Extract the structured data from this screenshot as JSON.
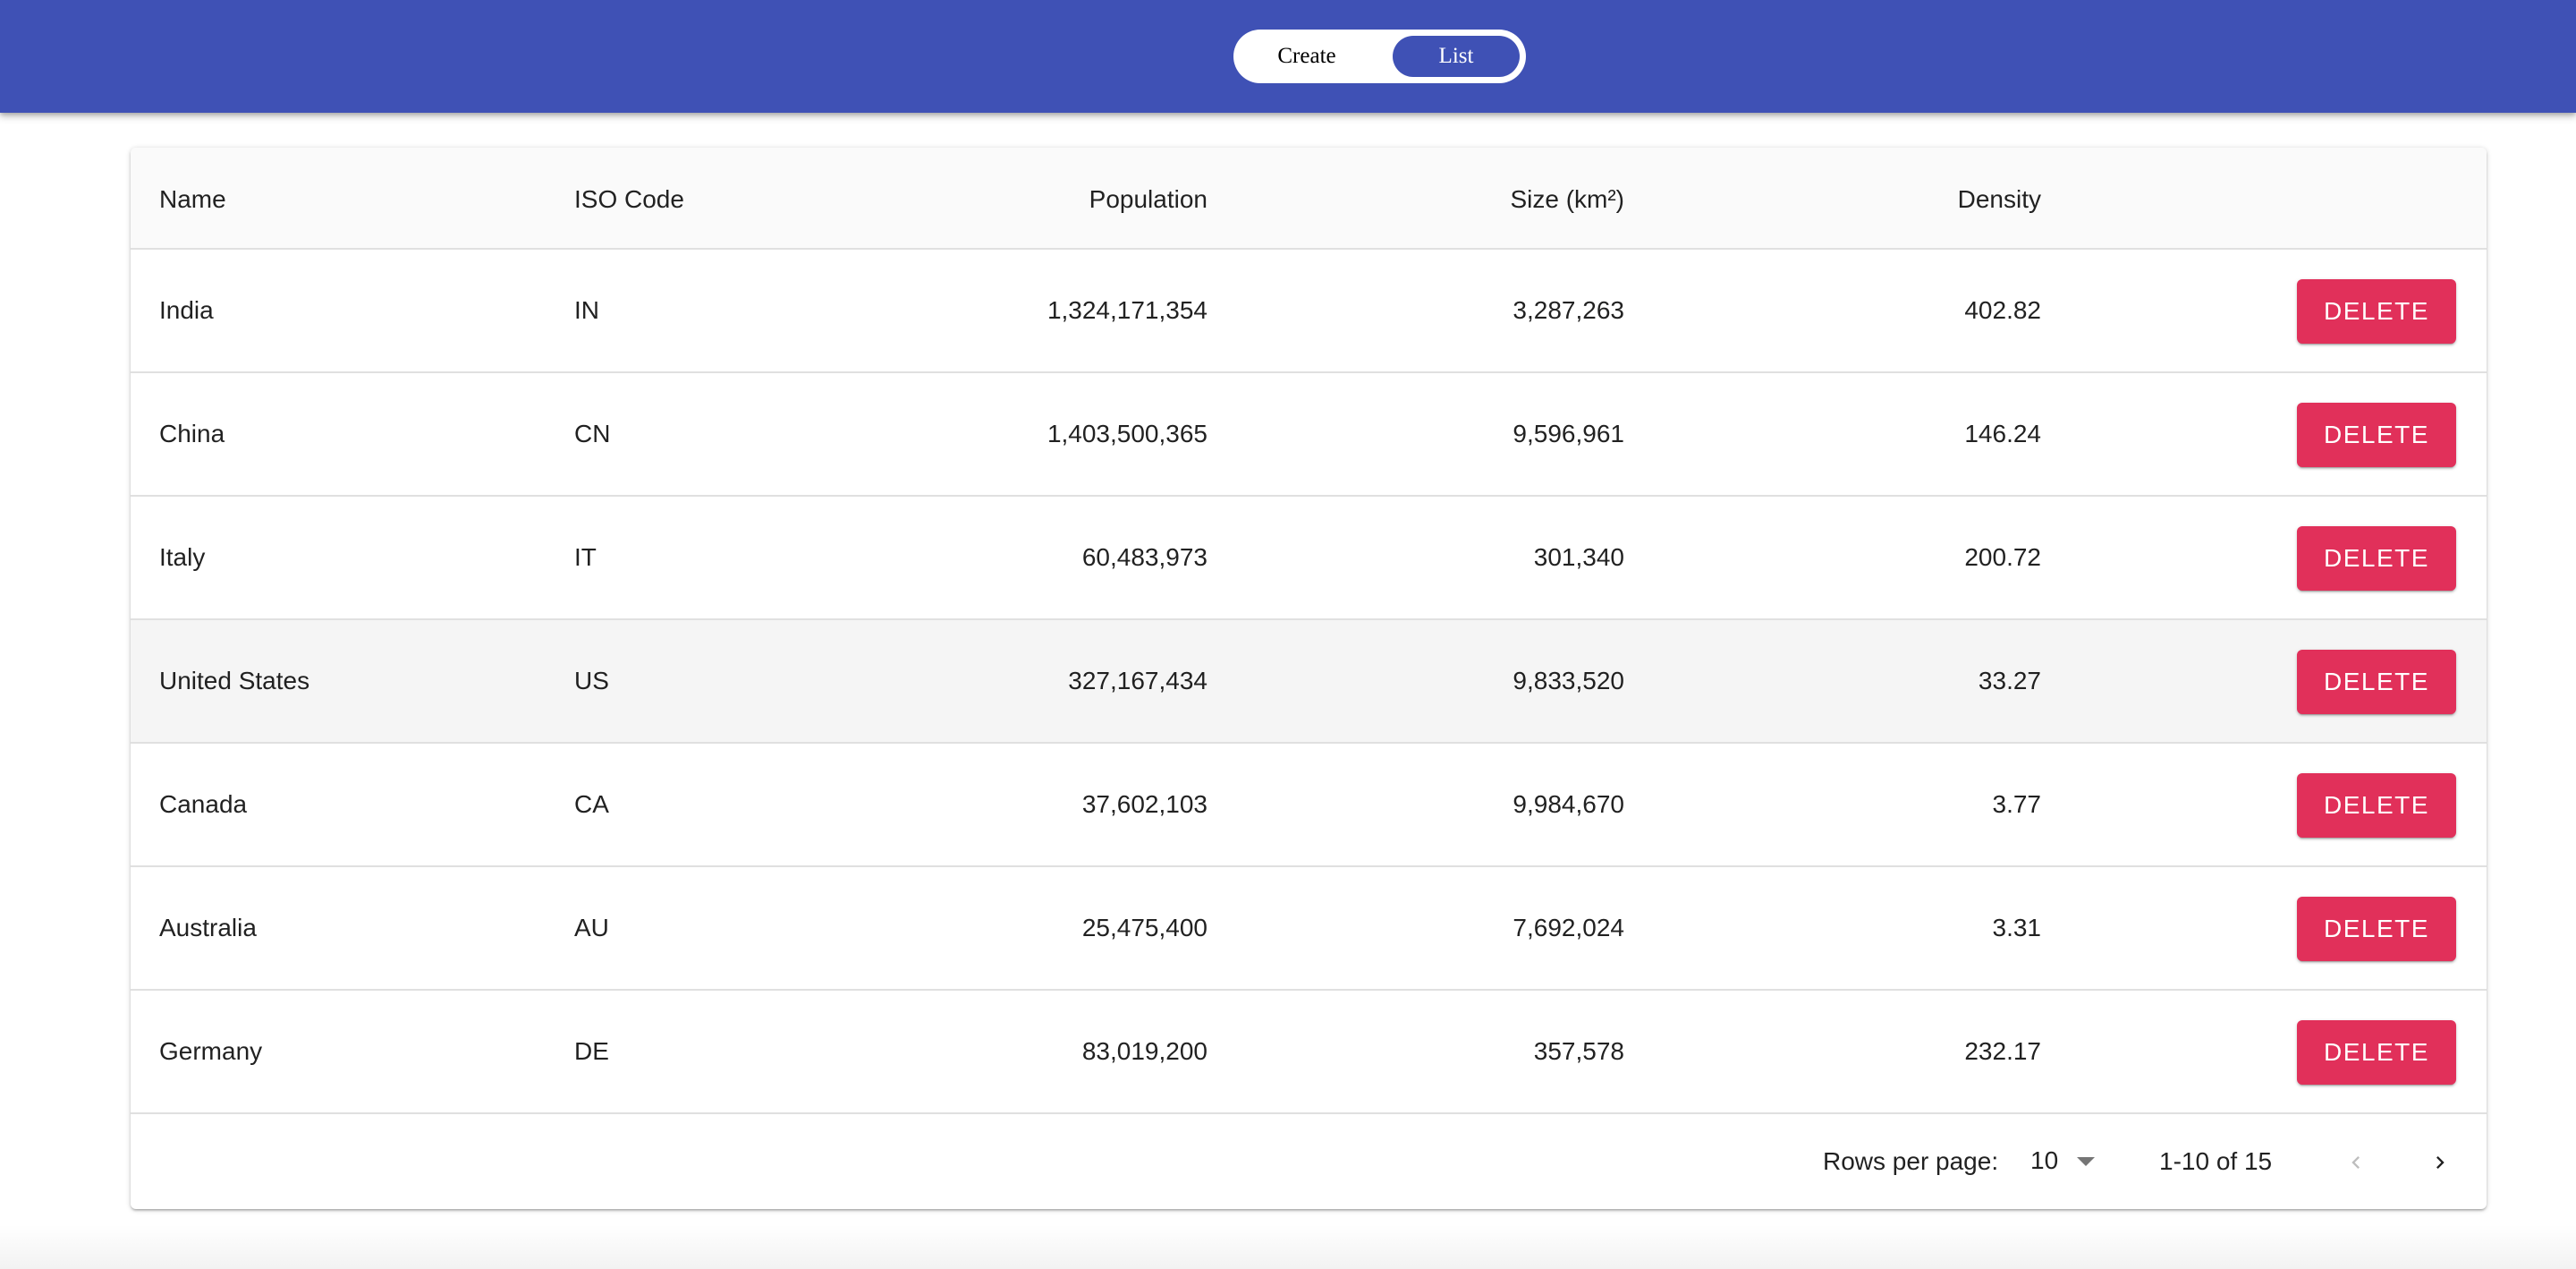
{
  "nav": {
    "create_label": "Create",
    "list_label": "List",
    "active": "List"
  },
  "table": {
    "headers": {
      "name": "Name",
      "iso": "ISO Code",
      "population": "Population",
      "size": "Size (km²)",
      "density": "Density"
    },
    "rows": [
      {
        "name": "India",
        "iso": "IN",
        "population": "1,324,171,354",
        "size": "3,287,263",
        "density": "402.82",
        "action": "DELETE"
      },
      {
        "name": "China",
        "iso": "CN",
        "population": "1,403,500,365",
        "size": "9,596,961",
        "density": "146.24",
        "action": "DELETE"
      },
      {
        "name": "Italy",
        "iso": "IT",
        "population": "60,483,973",
        "size": "301,340",
        "density": "200.72",
        "action": "DELETE"
      },
      {
        "name": "United States",
        "iso": "US",
        "population": "327,167,434",
        "size": "9,833,520",
        "density": "33.27",
        "action": "DELETE"
      },
      {
        "name": "Canada",
        "iso": "CA",
        "population": "37,602,103",
        "size": "9,984,670",
        "density": "3.77",
        "action": "DELETE"
      },
      {
        "name": "Australia",
        "iso": "AU",
        "population": "25,475,400",
        "size": "7,692,024",
        "density": "3.31",
        "action": "DELETE"
      },
      {
        "name": "Germany",
        "iso": "DE",
        "population": "83,019,200",
        "size": "357,578",
        "density": "232.17",
        "action": "DELETE"
      }
    ]
  },
  "pagination": {
    "rows_per_page_label": "Rows per page:",
    "rows_per_page_value": "10",
    "range_text": "1-10 of 15",
    "prev_icon": "chevron-left-icon",
    "next_icon": "chevron-right-icon"
  },
  "colors": {
    "app_bar": "#3f51b5",
    "delete_button": "#e1305a",
    "hover_row": "#f5f5f5",
    "header_bg": "#fafafa"
  }
}
